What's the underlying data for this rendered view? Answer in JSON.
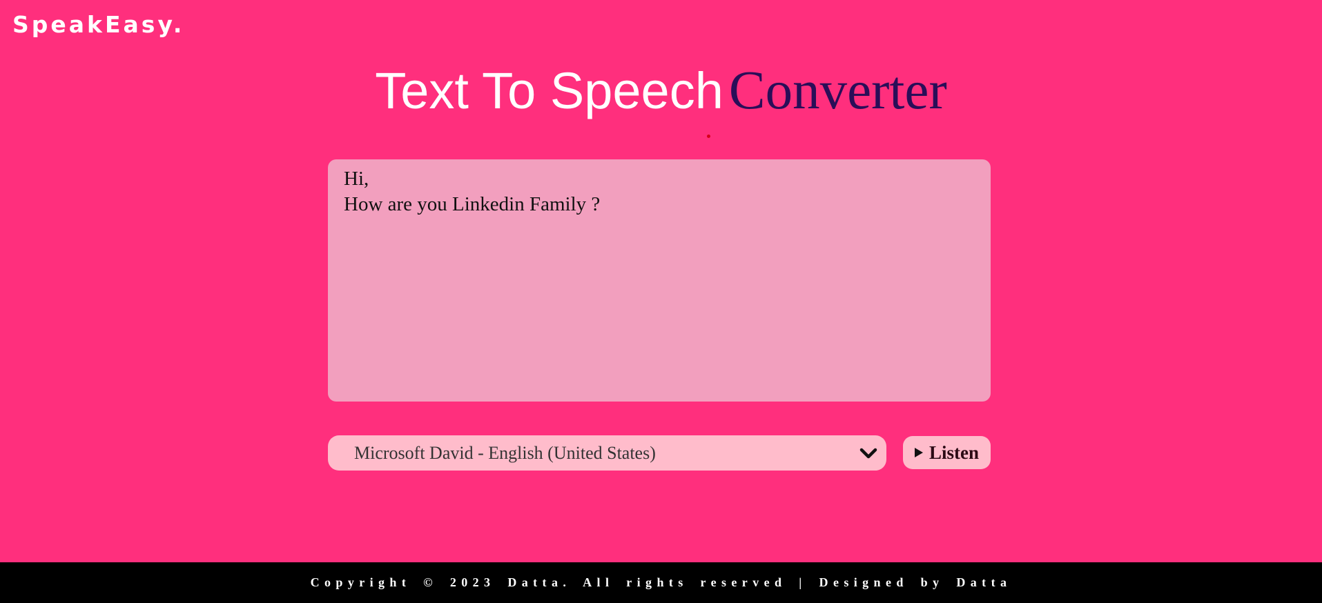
{
  "header": {
    "logo": "SpeakEasy."
  },
  "title": {
    "main": "Text To Speech",
    "accent": "Converter"
  },
  "editor": {
    "value": "Hi,\nHow are you Linkedin Family ?"
  },
  "controls": {
    "voice_selected": "Microsoft David - English (United States)",
    "voice_icon": "chevron-down-icon",
    "listen_label": "Listen",
    "listen_icon": "play-icon"
  },
  "footer": {
    "text": "Copyright © 2023 Datta. All rights reserved | Designed by Datta"
  },
  "colors": {
    "background": "#ff2f7d",
    "accent_title": "#2a0e58",
    "textarea_bg": "#f29fbe",
    "control_bg": "#ffbccb",
    "footer_bg": "#000000"
  }
}
